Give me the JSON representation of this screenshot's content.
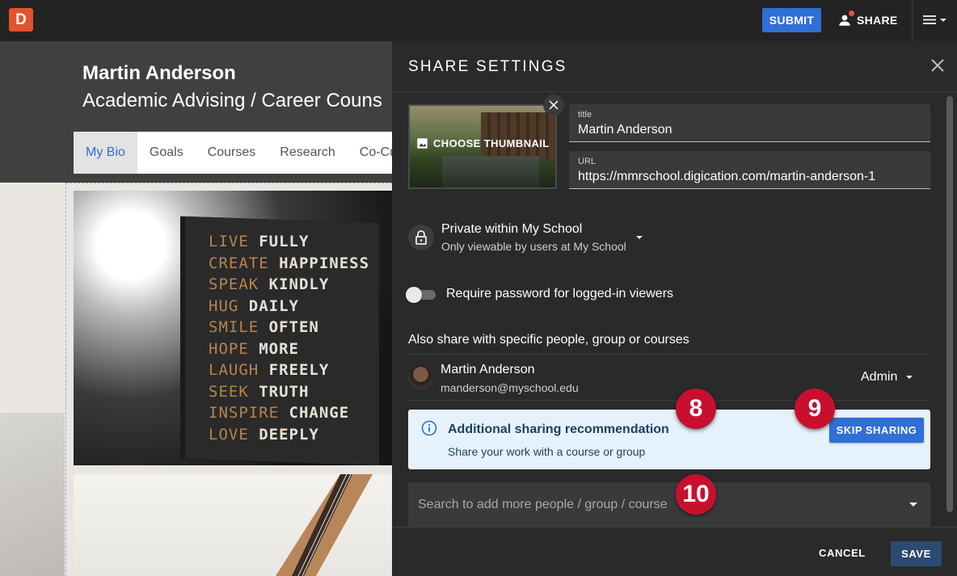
{
  "app": {
    "logo_letter": "D"
  },
  "topbar": {
    "submit_label": "SUBMIT",
    "share_label": "SHARE"
  },
  "page": {
    "name": "Martin Anderson",
    "subtitle": "Academic Advising / Career Couns",
    "nav": [
      "My Bio",
      "Goals",
      "Courses",
      "Research",
      "Co-Cu"
    ],
    "book_words": [
      [
        "LIVE",
        "FULLY"
      ],
      [
        "CREATE",
        "HAPPINESS"
      ],
      [
        "SPEAK",
        "KINDLY"
      ],
      [
        "HUG",
        "DAILY"
      ],
      [
        "SMILE",
        "OFTEN"
      ],
      [
        "HOPE",
        "MORE"
      ],
      [
        "LAUGH",
        "FREELY"
      ],
      [
        "SEEK",
        "TRUTH"
      ],
      [
        "INSPIRE",
        "CHANGE"
      ],
      [
        "LOVE",
        "DEEPLY"
      ]
    ]
  },
  "share": {
    "title": "SHARE SETTINGS",
    "thumbnail_label": "CHOOSE THUMBNAIL",
    "title_field": {
      "label": "title",
      "value": "Martin Anderson"
    },
    "url_field": {
      "label": "URL",
      "value": "https://mmrschool.digication.com/martin-anderson-1"
    },
    "privacy": {
      "title": "Private within My School",
      "subtitle": "Only viewable by users at My School"
    },
    "password_toggle": {
      "label": "Require password for logged-in viewers",
      "on": false
    },
    "also_share_label": "Also share with specific people, group or courses",
    "person": {
      "name": "Martin Anderson",
      "email": "manderson@myschool.edu",
      "role": "Admin"
    },
    "recommendation": {
      "title": "Additional sharing recommendation",
      "subtitle": "Share your work with a course or group",
      "skip_label": "SKIP SHARING"
    },
    "search_placeholder": "Search to add more people / group / course",
    "cancel_label": "CANCEL",
    "save_label": "SAVE"
  },
  "markers": [
    "8",
    "9",
    "10"
  ],
  "colors": {
    "accent": "#2f6fd6",
    "marker": "#c8102e",
    "reco_bg": "#e5f2fb",
    "logo": "#e2542c"
  }
}
